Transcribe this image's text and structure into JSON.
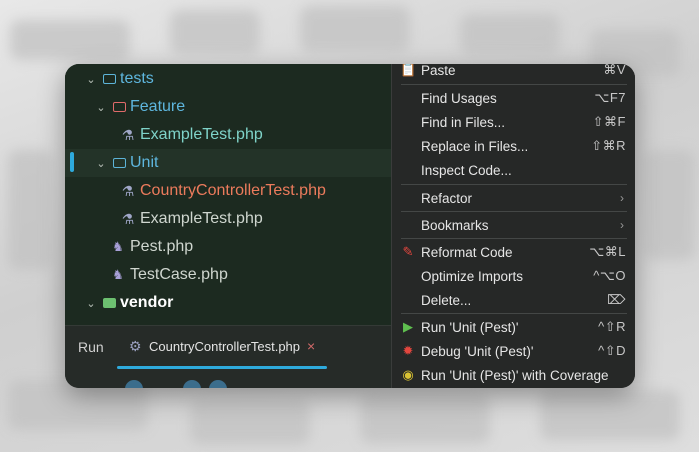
{
  "project_tree": {
    "items": [
      {
        "label": "tests",
        "caret": "⌄",
        "icon": "folder-icon"
      },
      {
        "label": "Feature",
        "caret": "⌄",
        "icon": "folder-red-icon"
      },
      {
        "label": "ExampleTest.php",
        "icon": "flask-icon"
      },
      {
        "label": "Unit",
        "caret": "⌄",
        "icon": "folder-icon"
      },
      {
        "label": "CountryControllerTest.php",
        "icon": "flask-icon"
      },
      {
        "label": "ExampleTest.php",
        "icon": "flask-icon"
      },
      {
        "label": "Pest.php",
        "icon": "php-icon"
      },
      {
        "label": "TestCase.php",
        "icon": "php-icon"
      },
      {
        "label": "vendor",
        "caret": "⌄",
        "icon": "folder-green-icon"
      }
    ]
  },
  "run_panel": {
    "title": "Run",
    "tab_label": "CountryControllerTest.php",
    "close_glyph": "×"
  },
  "context_menu": {
    "paste": {
      "label": "Paste",
      "shortcut": "⌘V"
    },
    "find_usages": {
      "label": "Find Usages",
      "shortcut": "⌥F7"
    },
    "find_in_files": {
      "label": "Find in Files...",
      "shortcut": "⇧⌘F"
    },
    "replace_in_files": {
      "label": "Replace in Files...",
      "shortcut": "⇧⌘R"
    },
    "inspect_code": {
      "label": "Inspect Code..."
    },
    "refactor": {
      "label": "Refactor"
    },
    "bookmarks": {
      "label": "Bookmarks"
    },
    "reformat_code": {
      "label": "Reformat Code",
      "shortcut": "⌥⌘L"
    },
    "optimize_imports": {
      "label": "Optimize Imports",
      "shortcut": "^⌥O"
    },
    "delete": {
      "label": "Delete...",
      "shortcut": "⌦"
    },
    "run_unit": {
      "label": "Run 'Unit (Pest)'",
      "shortcut": "^⇧R"
    },
    "debug_unit": {
      "label": "Debug 'Unit (Pest)'",
      "shortcut": "^⇧D"
    },
    "run_coverage": {
      "label": "Run 'Unit (Pest)' with Coverage"
    }
  },
  "colors": {
    "accent": "#2eaadc",
    "test_failed": "#ec7b5c",
    "run_green": "#5fbf4f",
    "debug_red": "#e2463e",
    "coverage_yellow": "#d9c233"
  }
}
